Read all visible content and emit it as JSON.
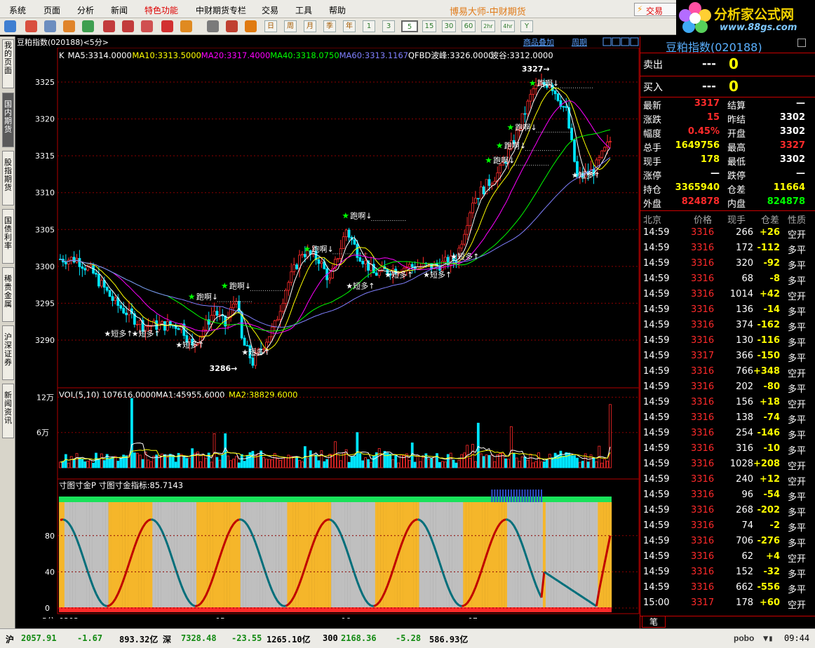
{
  "menu": [
    "系统",
    "页面",
    "分析",
    "新闻",
    "特色功能",
    "中财期货专栏",
    "交易",
    "工具",
    "帮助"
  ],
  "app_title": "博易大师-中财期货",
  "trade_button": "交易",
  "logo": {
    "text": "分析家公式网",
    "url": "www.88gs.com"
  },
  "period_buttons": [
    "日",
    "周",
    "月",
    "季",
    "年",
    "1",
    "3",
    "5",
    "15",
    "30",
    "60",
    "2hr",
    "4hr",
    "Y"
  ],
  "selected_period": "5",
  "sidebar_tabs": [
    "我的页面",
    "国内期货",
    "股指期货",
    "国债利率",
    "稀贵金属",
    "沪深证券",
    "新闻资讯"
  ],
  "chart_header": {
    "name": "豆粕指数",
    "code": "(020188)",
    "period": "<5分>",
    "buttons": [
      "商品叠加",
      "周期"
    ]
  },
  "ma_line": {
    "k": "K",
    "ma5": "MA5:3314.0000",
    "ma10": "MA10:3313.5000",
    "ma20": "MA20:3317.4000",
    "ma40": "MA40:3318.0750",
    "ma60": "MA60:3313.1167",
    "qfbd": "QFBD",
    "peak": "波峰:3326.0000",
    "valley": "波谷:3312.0000"
  },
  "price_axis": [
    "3325",
    "3320",
    "3315",
    "3310",
    "3305",
    "3300",
    "3295",
    "3290"
  ],
  "vol_line": {
    "label": "VOL(5,10)",
    "vol": "107616.0000",
    "ma1": "MA1:45955.6000",
    "ma2": "MA2:38829.6000"
  },
  "vol_axis": [
    "12万",
    "6万"
  ],
  "ind_line": {
    "name": "寸图寸金P",
    "value": "寸图寸金指标:85.7143"
  },
  "ind_axis": [
    "80",
    "40",
    "0"
  ],
  "time_axis": {
    "period": "5分",
    "labels": [
      "0303",
      "05",
      "06",
      "07"
    ]
  },
  "markers": {
    "high": "3327",
    "low": "3286",
    "hold": "持多",
    "exit": "跑啊",
    "prefix": "★",
    "entry": "★短多↑"
  },
  "quote": {
    "title": "豆粕指数(020188)",
    "sell": {
      "label": "卖出",
      "price": "---",
      "vol": "0"
    },
    "buy": {
      "label": "买入",
      "price": "---",
      "vol": "0"
    },
    "fields": [
      {
        "l1": "最新",
        "v1": "3317",
        "l2": "结算",
        "v2": "—"
      },
      {
        "l1": "涨跌",
        "v1": "15",
        "l2": "昨结",
        "v2": "3302"
      },
      {
        "l1": "幅度",
        "v1": "0.45%",
        "l2": "开盘",
        "v2": "3302"
      },
      {
        "l1": "总手",
        "v1": "1649756",
        "l2": "最高",
        "v2": "3327"
      },
      {
        "l1": "现手",
        "v1": "178",
        "l2": "最低",
        "v2": "3302"
      },
      {
        "l1": "涨停",
        "v1": "—",
        "l2": "跌停",
        "v2": "—"
      },
      {
        "l1": "持仓",
        "v1": "3365940",
        "l2": "仓差",
        "v2": "11664"
      },
      {
        "l1": "外盘",
        "v1": "824878",
        "l2": "内盘",
        "v2": "824878"
      }
    ],
    "tick_headers": [
      "北京",
      "价格",
      "现手",
      "仓差",
      "性质"
    ],
    "ticks": [
      [
        "14:59",
        "3316",
        "266",
        "+26",
        "空开"
      ],
      [
        "14:59",
        "3316",
        "172",
        "-112",
        "多平"
      ],
      [
        "14:59",
        "3316",
        "320",
        "-92",
        "多平"
      ],
      [
        "14:59",
        "3316",
        "68",
        "-8",
        "多平"
      ],
      [
        "14:59",
        "3316",
        "1014",
        "+42",
        "空开"
      ],
      [
        "14:59",
        "3316",
        "136",
        "-14",
        "多平"
      ],
      [
        "14:59",
        "3316",
        "374",
        "-162",
        "多平"
      ],
      [
        "14:59",
        "3316",
        "130",
        "-116",
        "多平"
      ],
      [
        "14:59",
        "3317",
        "366",
        "-150",
        "多平"
      ],
      [
        "14:59",
        "3316",
        "766",
        "+348",
        "空开"
      ],
      [
        "14:59",
        "3316",
        "202",
        "-80",
        "多平"
      ],
      [
        "14:59",
        "3316",
        "156",
        "+18",
        "空开"
      ],
      [
        "14:59",
        "3316",
        "138",
        "-74",
        "多平"
      ],
      [
        "14:59",
        "3316",
        "254",
        "-146",
        "多平"
      ],
      [
        "14:59",
        "3316",
        "316",
        "-10",
        "多平"
      ],
      [
        "14:59",
        "3316",
        "1028",
        "+208",
        "空开"
      ],
      [
        "14:59",
        "3316",
        "240",
        "+12",
        "空开"
      ],
      [
        "14:59",
        "3316",
        "96",
        "-54",
        "多平"
      ],
      [
        "14:59",
        "3316",
        "268",
        "-202",
        "多平"
      ],
      [
        "14:59",
        "3316",
        "74",
        "-2",
        "多平"
      ],
      [
        "14:59",
        "3316",
        "706",
        "-276",
        "多平"
      ],
      [
        "14:59",
        "3316",
        "62",
        "+4",
        "空开"
      ],
      [
        "14:59",
        "3316",
        "152",
        "-32",
        "多平"
      ],
      [
        "14:59",
        "3316",
        "662",
        "-556",
        "多平"
      ],
      [
        "15:00",
        "3317",
        "178",
        "+60",
        "空开"
      ]
    ],
    "bottom_tab": "笔"
  },
  "status": {
    "sh": {
      "label": "沪",
      "index": "2057.91",
      "chg": "-1.67",
      "amt": "893.32亿"
    },
    "sz": {
      "label": "深",
      "index": "7328.48",
      "chg": "-23.55",
      "amt": "1265.10亿"
    },
    "c300": {
      "label": "300",
      "index": "2168.36",
      "chg": "-5.28",
      "amt": "586.93亿"
    },
    "brand": "pobo",
    "time": "09:44"
  },
  "colors": {
    "up": "#ff2a2a",
    "down": "#00e5ff",
    "ma5": "#ffffff",
    "ma10": "#ffff00",
    "ma20": "#ff00ff",
    "ma40": "#00ff00",
    "ma60": "#8080ff",
    "grid": "#8b0000"
  }
}
